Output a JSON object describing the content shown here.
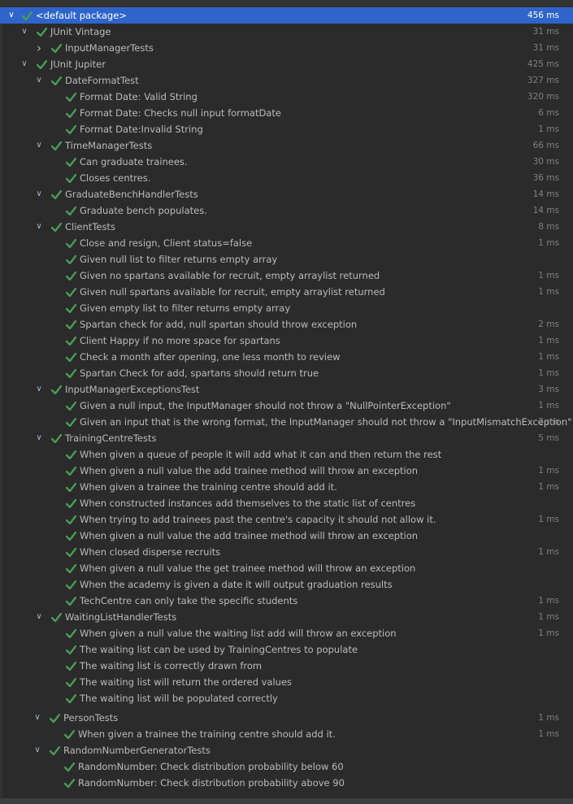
{
  "colors": {
    "pass": "#499c54",
    "selection": "#2f65ca",
    "background": "#2b2b2b"
  },
  "tree": [
    {
      "label": "<default package>",
      "time": "456 ms",
      "level": 0,
      "expanded": true,
      "selected": true
    },
    {
      "label": "JUnit Vintage",
      "time": "31 ms",
      "level": 1,
      "expanded": true
    },
    {
      "label": "InputManagerTests",
      "time": "31 ms",
      "level": 2,
      "expanded": false
    },
    {
      "label": "JUnit Jupiter",
      "time": "425 ms",
      "level": 1,
      "expanded": true
    },
    {
      "label": "DateFormatTest",
      "time": "327 ms",
      "level": 2,
      "expanded": true
    },
    {
      "label": "Format Date: Valid String",
      "time": "320 ms",
      "level": 3
    },
    {
      "label": "Format Date: Checks null input formatDate",
      "time": "6 ms",
      "level": 3
    },
    {
      "label": "Format Date:Invalid String",
      "time": "1 ms",
      "level": 3
    },
    {
      "label": "TimeManagerTests",
      "time": "66 ms",
      "level": 2,
      "expanded": true
    },
    {
      "label": "Can graduate trainees.",
      "time": "30 ms",
      "level": 3
    },
    {
      "label": "Closes centres.",
      "time": "36 ms",
      "level": 3
    },
    {
      "label": "GraduateBenchHandlerTests",
      "time": "14 ms",
      "level": 2,
      "expanded": true
    },
    {
      "label": "Graduate bench populates.",
      "time": "14 ms",
      "level": 3
    },
    {
      "label": "ClientTests",
      "time": "8 ms",
      "level": 2,
      "expanded": true
    },
    {
      "label": "Close and resign, Client status=false",
      "time": "1 ms",
      "level": 3
    },
    {
      "label": "Given null list to filter returns empty array",
      "time": "",
      "level": 3
    },
    {
      "label": "Given no spartans available for recruit, empty arraylist returned",
      "time": "1 ms",
      "level": 3
    },
    {
      "label": "Given null spartans available for recruit, empty arraylist returned",
      "time": "1 ms",
      "level": 3
    },
    {
      "label": "Given empty list to filter returns empty array",
      "time": "",
      "level": 3
    },
    {
      "label": "Spartan check for add, null spartan should throw exception",
      "time": "2 ms",
      "level": 3
    },
    {
      "label": "Client Happy if no more space for spartans",
      "time": "1 ms",
      "level": 3
    },
    {
      "label": "Check a month after opening, one less month to review",
      "time": "1 ms",
      "level": 3
    },
    {
      "label": "Spartan Check for add, spartans should return true",
      "time": "1 ms",
      "level": 3
    },
    {
      "label": "InputManagerExceptionsTest",
      "time": "3 ms",
      "level": 2,
      "expanded": true
    },
    {
      "label": "Given a null input, the InputManager should not throw a \"NullPointerException\"",
      "time": "1 ms",
      "level": 3
    },
    {
      "label": "Given an input that is the wrong format, the InputManager should not throw a \"InputMismatchException\"",
      "time": "2 ms",
      "level": 3
    },
    {
      "label": "TrainingCentreTests",
      "time": "5 ms",
      "level": 2,
      "expanded": true
    },
    {
      "label": "When given a queue of people it will add what it can and then return the rest",
      "time": "",
      "level": 3
    },
    {
      "label": "When given a null value the add trainee method will throw an exception",
      "time": "1 ms",
      "level": 3
    },
    {
      "label": "When given a trainee the training centre should add it.",
      "time": "1 ms",
      "level": 3
    },
    {
      "label": "When constructed instances add themselves to the static list of centres",
      "time": "",
      "level": 3
    },
    {
      "label": "When trying to add trainees past the centre's capacity it should not allow it.",
      "time": "1 ms",
      "level": 3
    },
    {
      "label": "When given a null value the add trainee method will throw an exception",
      "time": "",
      "level": 3
    },
    {
      "label": "When closed disperse recruits",
      "time": "1 ms",
      "level": 3
    },
    {
      "label": "When given a null value the get trainee method will throw an exception",
      "time": "",
      "level": 3
    },
    {
      "label": "When the academy is given a date it will output graduation results",
      "time": "",
      "level": 3
    },
    {
      "label": "TechCentre can only take the specific students",
      "time": "1 ms",
      "level": 3
    },
    {
      "label": "WaitingListHandlerTests",
      "time": "1 ms",
      "level": 2,
      "expanded": true
    },
    {
      "label": "When given a null value the waiting list add will throw an exception",
      "time": "1 ms",
      "level": 3
    },
    {
      "label": "The waiting list can be used by TrainingCentres to populate",
      "time": "",
      "level": 3
    },
    {
      "label": "The waiting list is correctly drawn from",
      "time": "",
      "level": 3
    },
    {
      "label": "The waiting list will return the ordered values",
      "time": "",
      "level": 3
    },
    {
      "label": "The waiting list will be populated correctly",
      "time": "",
      "level": 3
    }
  ],
  "tree_lower": [
    {
      "label": "PersonTests",
      "time": "1 ms",
      "level": 2,
      "expanded": true
    },
    {
      "label": "When given a trainee the training centre should add it.",
      "time": "1 ms",
      "level": 3
    },
    {
      "label": "RandomNumberGeneratorTests",
      "time": "",
      "level": 2,
      "expanded": true
    },
    {
      "label": "RandomNumber: Check distribution probability below 60",
      "time": "",
      "level": 3
    },
    {
      "label": "RandomNumber: Check distribution probability above 90",
      "time": "",
      "level": 3
    }
  ]
}
